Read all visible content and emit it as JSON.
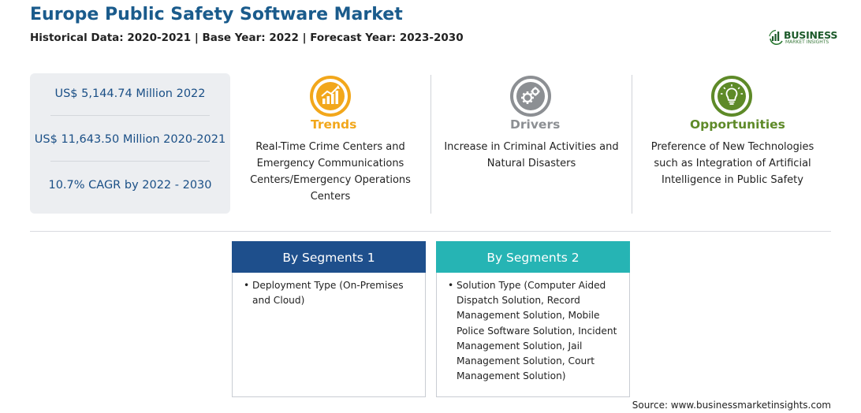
{
  "header": {
    "title": "Europe Public Safety Software Market",
    "subtitle": "Historical Data: 2020-2021 | Base Year: 2022 | Forecast Year: 2023-2030"
  },
  "logo": {
    "name": "BUSINESS",
    "tagline": "MARKET INSIGHTS",
    "icon": "bar-chart-globe-logo",
    "color": "#1c5a2a"
  },
  "stats": [
    "US$ 5,144.74 Million 2022",
    "US$ 11,643.50 Million 2020-2021",
    "10.7% CAGR by 2022 - 2030"
  ],
  "columns": [
    {
      "heading": "Trends",
      "color": "#f2a71b",
      "icon": "trending-chart-icon",
      "text": "Real-Time Crime Centers and Emergency Communications Centers/Emergency Operations Centers"
    },
    {
      "heading": "Drivers",
      "color": "#8c8f93",
      "icon": "gears-icon",
      "text": "Increase in Criminal Activities and Natural Disasters"
    },
    {
      "heading": "Opportunities",
      "color": "#5e8a28",
      "icon": "lightbulb-icon",
      "text": "Preference of New Technologies such as Integration of Artificial Intelligence in Public Safety"
    }
  ],
  "segments": [
    {
      "title": "By Segments 1",
      "color": "#1e4f8c",
      "items": [
        "Deployment Type (On-Premises and Cloud)"
      ]
    },
    {
      "title": "By Segments 2",
      "color": "#26b4b4",
      "items": [
        "Solution Type (Computer Aided Dispatch Solution, Record Management Solution, Mobile Police Software Solution, Incident Management Solution, Jail Management Solution, Court Management Solution)"
      ]
    }
  ],
  "bullet": "•",
  "source": "Source: www.businessmarketinsights.com"
}
